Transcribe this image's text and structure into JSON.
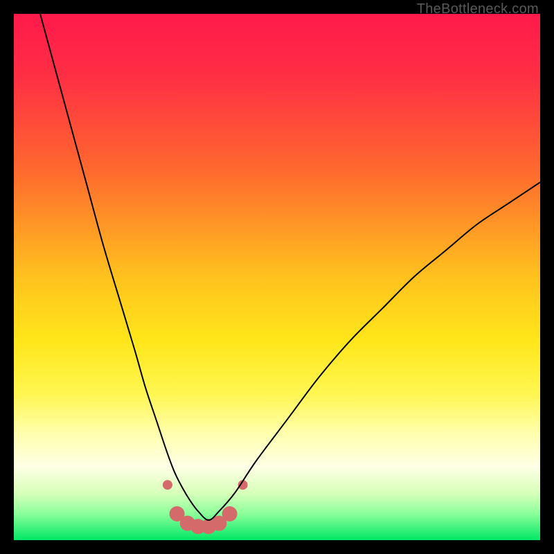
{
  "watermark": "TheBottleneck.com",
  "chart_data": {
    "type": "line",
    "title": "",
    "xlabel": "",
    "ylabel": "",
    "xlim": [
      0,
      100
    ],
    "ylim": [
      0,
      100
    ],
    "gradient_stops": [
      {
        "offset": 0.0,
        "color": "#ff1a4b"
      },
      {
        "offset": 0.12,
        "color": "#ff2f44"
      },
      {
        "offset": 0.3,
        "color": "#ff6a2e"
      },
      {
        "offset": 0.5,
        "color": "#ffc21e"
      },
      {
        "offset": 0.62,
        "color": "#ffe61a"
      },
      {
        "offset": 0.72,
        "color": "#fff650"
      },
      {
        "offset": 0.8,
        "color": "#ffffb0"
      },
      {
        "offset": 0.86,
        "color": "#ffffe6"
      },
      {
        "offset": 0.91,
        "color": "#d8ffba"
      },
      {
        "offset": 0.95,
        "color": "#8bff9a"
      },
      {
        "offset": 1.0,
        "color": "#00e865"
      }
    ],
    "series": [
      {
        "name": "bottleneck-curve",
        "color": "#000000",
        "width": 2,
        "x": [
          5,
          8,
          11,
          14,
          17,
          20,
          23,
          25,
          27,
          29,
          30.5,
          32,
          33.5,
          35,
          37,
          39,
          42,
          46,
          52,
          58,
          64,
          70,
          76,
          82,
          88,
          94,
          100
        ],
        "y": [
          100,
          89,
          78,
          67,
          56,
          46,
          36,
          29,
          23,
          17,
          13,
          10,
          7.5,
          5.5,
          3.8,
          5.5,
          9,
          15,
          23,
          31,
          38,
          44,
          50,
          55,
          60,
          64,
          68
        ]
      }
    ],
    "marker_series": {
      "name": "trough-markers",
      "color": "#d46a6a",
      "radius_small": 7,
      "radius_large": 11,
      "points": [
        {
          "x": 29.2,
          "y": 10.5,
          "r": "small"
        },
        {
          "x": 31.0,
          "y": 5.0,
          "r": "large"
        },
        {
          "x": 33.0,
          "y": 3.2,
          "r": "large"
        },
        {
          "x": 35.0,
          "y": 2.6,
          "r": "large"
        },
        {
          "x": 37.0,
          "y": 2.6,
          "r": "large"
        },
        {
          "x": 39.0,
          "y": 3.2,
          "r": "large"
        },
        {
          "x": 41.0,
          "y": 5.0,
          "r": "large"
        },
        {
          "x": 43.5,
          "y": 10.5,
          "r": "small"
        }
      ]
    }
  }
}
